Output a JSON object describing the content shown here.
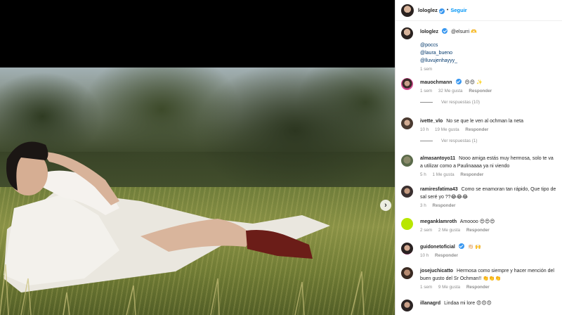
{
  "colors": {
    "link": "#0095f6",
    "verified": "#3897f0",
    "muted": "#8e8e8e",
    "text": "#262626"
  },
  "header": {
    "username": "lologlez",
    "follow_label": "Seguir",
    "separator": "•"
  },
  "caption": {
    "username": "lologlez",
    "text": "@elsurri 🫶",
    "mentions": [
      "@poccs",
      "@laura_bueno",
      "@lluvujenhayyy_"
    ],
    "time": "1 sem"
  },
  "comments": [
    {
      "username": "mauochmann",
      "text": "😍😍 ✨",
      "time": "1 sem",
      "likes": "32 Me gusta",
      "reply": "Responder",
      "replies": "Ver respuestas (10)"
    },
    {
      "username": "ivette_vlo",
      "text": "No se que le ven al ochman la neta",
      "time": "10 h",
      "likes": "19 Me gusta",
      "reply": "Responder",
      "replies": "Ver respuestas (1)"
    },
    {
      "username": "almasantoyo11",
      "text": "Nooo amiga estás muy hermosa, solo te va a utilizar como a Paulinaaaa ya ni viendo",
      "time": "5 h",
      "likes": "1 Me gusta",
      "reply": "Responder"
    },
    {
      "username": "ramiresfatima43",
      "text": "Como se enamoran tan rápido, Que tipo de sal seré yo ??😂😂😂",
      "time": "3 h",
      "reply": "Responder"
    },
    {
      "username": "meganklamroth",
      "text": "Amoooo 😍😍😍",
      "time": "2 sem",
      "likes": "2 Me gusta",
      "reply": "Responder"
    },
    {
      "username": "guidonetoficial",
      "text": "👏🏻 🙌",
      "time": "10 h",
      "reply": "Responder"
    },
    {
      "username": "josejuchicatto",
      "text": "Hermosa como siempre y hacer mención del buen gusto del Sr Ochman!! 👏👏👏",
      "time": "1 sem",
      "likes": "9 Me gusta",
      "reply": "Responder"
    },
    {
      "username": "illanagrd",
      "text": "Lindaa mi lore 😍😍😍"
    }
  ]
}
